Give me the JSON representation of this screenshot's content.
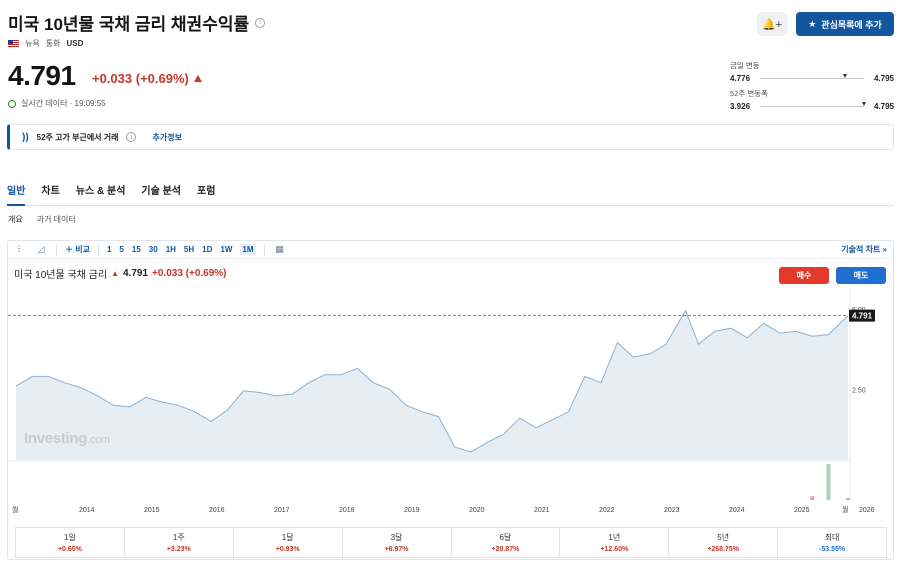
{
  "header": {
    "title": "미국 10년물 국채 금리 채권수익률",
    "region": "뉴욕",
    "currency_label": "통화",
    "currency": "USD",
    "alert_label": "🔔+",
    "watchlist_label": "관심목록에 추가"
  },
  "quote": {
    "price": "4.791",
    "change": "+0.033 (+0.69%)",
    "realtime_label": "실시간 데이터 · 19:09:55"
  },
  "ranges": {
    "day_label": "금일 변동",
    "day_low": "4.776",
    "day_high": "4.795",
    "day_position": 0.8,
    "week52_label": "52주 변동폭",
    "week52_low": "3.926",
    "week52_high": "4.795",
    "week52_position": 0.98
  },
  "banner": {
    "text": "52주 고가 부근에서 거래",
    "link": "추가정보"
  },
  "tabs": [
    "일반",
    "차트",
    "뉴스 & 분석",
    "기술 분석",
    "포럼"
  ],
  "subtabs": [
    "개요",
    "과거 데이터"
  ],
  "toolbar": {
    "compare_label": "비교",
    "intervals": [
      "1",
      "5",
      "15",
      "30",
      "1H",
      "5H",
      "1D",
      "1W",
      "1M"
    ],
    "active_interval": "1M",
    "technical_link": "기술적 차트 »"
  },
  "legend": {
    "name": "미국 10년물 국채 금리",
    "last": "4.791",
    "change": "+0.033 (+0.69%)"
  },
  "trade": {
    "buy": "매수",
    "sell": "매도"
  },
  "watermark": {
    "brand": "Investing",
    "suffix": ".com"
  },
  "colors": {
    "accent": "#1256a0",
    "up": "#c0392b",
    "down": "#1f6fd1",
    "area_fill": "#e6edf3",
    "area_line": "#8fb0cf"
  },
  "chart_data": {
    "type": "area",
    "y_ticks": [
      "5.00",
      "2.50"
    ],
    "ylim": [
      0.3,
      5.4
    ],
    "x_labels": [
      "월",
      "2014",
      "2015",
      "2016",
      "2017",
      "2018",
      "2019",
      "2020",
      "2021",
      "2022",
      "2023",
      "2024",
      "2025",
      "2026",
      "월"
    ],
    "last_label": "4.791",
    "reference_line": 4.791,
    "x": [
      2013.5,
      2013.75,
      2014.0,
      2014.25,
      2014.5,
      2014.75,
      2015.0,
      2015.25,
      2015.5,
      2015.75,
      2016.0,
      2016.25,
      2016.5,
      2016.75,
      2017.0,
      2017.25,
      2017.5,
      2017.75,
      2018.0,
      2018.25,
      2018.5,
      2018.75,
      2019.0,
      2019.25,
      2019.5,
      2019.75,
      2020.0,
      2020.25,
      2020.5,
      2020.75,
      2021.0,
      2021.25,
      2021.5,
      2021.75,
      2022.0,
      2022.25,
      2022.5,
      2022.75,
      2023.0,
      2023.25,
      2023.5,
      2023.8,
      2024.0,
      2024.25,
      2024.5,
      2024.75,
      2025.0,
      2025.25,
      2025.5,
      2025.75,
      2026.0,
      2026.3
    ],
    "y": [
      2.6,
      2.9,
      2.9,
      2.7,
      2.55,
      2.3,
      2.0,
      1.95,
      2.25,
      2.1,
      2.0,
      1.8,
      1.5,
      1.85,
      2.45,
      2.4,
      2.3,
      2.35,
      2.7,
      2.95,
      2.95,
      3.15,
      2.7,
      2.5,
      2.0,
      1.8,
      1.65,
      0.7,
      0.55,
      0.85,
      1.1,
      1.6,
      1.3,
      1.55,
      1.8,
      2.9,
      2.7,
      3.95,
      3.5,
      3.6,
      3.9,
      4.95,
      3.9,
      4.3,
      4.4,
      4.1,
      4.55,
      4.25,
      4.3,
      4.15,
      4.2,
      4.79
    ],
    "volume": [
      0,
      0,
      0,
      0,
      0,
      0,
      0,
      0,
      0,
      0,
      0,
      0,
      0,
      0,
      0,
      0,
      0,
      0,
      0,
      0,
      0,
      0,
      0,
      0,
      0,
      0,
      0,
      0,
      0,
      0,
      0,
      0,
      0,
      0,
      0,
      0,
      0,
      0,
      0,
      0,
      0,
      0,
      0,
      0,
      0,
      0,
      0,
      0,
      0,
      0.1,
      0.95,
      0.05
    ]
  },
  "performance": [
    {
      "label": "1일",
      "value": "+0.65%",
      "sign": "pos"
    },
    {
      "label": "1주",
      "value": "+3.23%",
      "sign": "pos"
    },
    {
      "label": "1달",
      "value": "+0.93%",
      "sign": "pos"
    },
    {
      "label": "3달",
      "value": "+6.97%",
      "sign": "pos"
    },
    {
      "label": "6달",
      "value": "+20.87%",
      "sign": "pos"
    },
    {
      "label": "1년",
      "value": "+12.60%",
      "sign": "pos"
    },
    {
      "label": "5년",
      "value": "+268.75%",
      "sign": "pos"
    },
    {
      "label": "최대",
      "value": "-53.55%",
      "sign": "neg"
    }
  ]
}
